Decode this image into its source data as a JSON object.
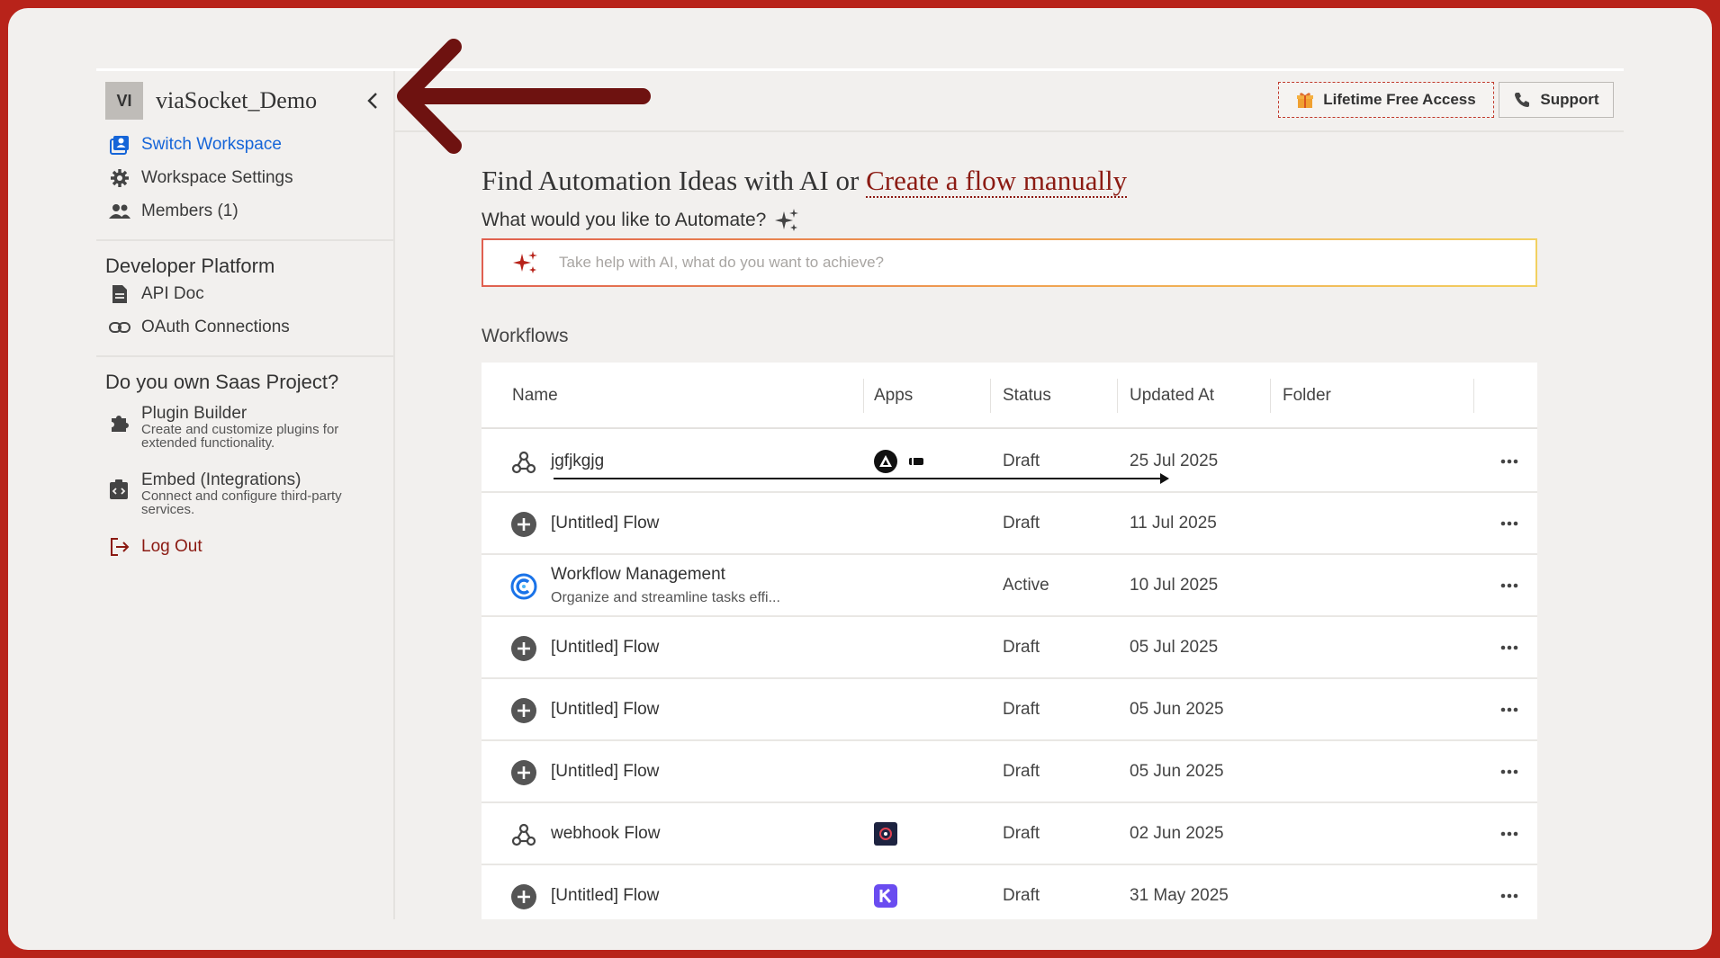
{
  "colors": {
    "frame": "#b8231a",
    "background": "#f2f0ee",
    "accent_blue": "#1565d8",
    "accent_red": "#8b1a12"
  },
  "sidebar": {
    "workspace_badge": "VI",
    "workspace_name": "viaSocket_Demo",
    "items": [
      {
        "label": "Switch Workspace",
        "icon": "switch-workspace-icon"
      },
      {
        "label": "Workspace Settings",
        "icon": "gear-icon"
      },
      {
        "label": "Members (1)",
        "icon": "members-icon"
      }
    ],
    "developer_title": "Developer Platform",
    "developer_items": [
      {
        "label": "API Doc",
        "icon": "document-icon"
      },
      {
        "label": "OAuth Connections",
        "icon": "link-icon"
      }
    ],
    "saas_title": "Do you own Saas Project?",
    "saas_items": [
      {
        "label": "Plugin Builder",
        "desc": "Create and customize plugins for extended functionality.",
        "icon": "puzzle-icon"
      },
      {
        "label": "Embed (Integrations)",
        "desc": "Connect and configure third-party services.",
        "icon": "embed-icon"
      }
    ],
    "logout": "Log Out"
  },
  "topbar": {
    "lifetime_label": "Lifetime Free Access",
    "support_label": "Support"
  },
  "main": {
    "headline_prefix": "Find Automation Ideas with AI or ",
    "headline_link": "Create a flow manually",
    "subhead": "What would you like to Automate?",
    "ai_placeholder": "Take help with AI, what do you want to achieve?",
    "workflows_title": "Workflows"
  },
  "table": {
    "columns": [
      "Name",
      "Apps",
      "Status",
      "Updated At",
      "Folder"
    ],
    "rows": [
      {
        "name": "jgfjkgjg",
        "desc": "",
        "status": "Draft",
        "updated": "25 Jul 2025",
        "icon": "webhook-icon",
        "apps": [
          "triangle-app-icon",
          "pill-app-icon"
        ]
      },
      {
        "name": "[Untitled] Flow",
        "desc": "",
        "status": "Draft",
        "updated": "11 Jul 2025",
        "icon": "plus-circle-icon",
        "apps": []
      },
      {
        "name": "Workflow Management",
        "desc": "Organize and streamline tasks effi...",
        "status": "Active",
        "updated": "10 Jul 2025",
        "icon": "calendly-icon",
        "apps": []
      },
      {
        "name": "[Untitled] Flow",
        "desc": "",
        "status": "Draft",
        "updated": "05 Jul 2025",
        "icon": "plus-circle-icon",
        "apps": []
      },
      {
        "name": "[Untitled] Flow",
        "desc": "",
        "status": "Draft",
        "updated": "05 Jun 2025",
        "icon": "plus-circle-icon",
        "apps": []
      },
      {
        "name": "[Untitled] Flow",
        "desc": "",
        "status": "Draft",
        "updated": "05 Jun 2025",
        "icon": "plus-circle-icon",
        "apps": []
      },
      {
        "name": "webhook Flow",
        "desc": "",
        "status": "Draft",
        "updated": "02 Jun 2025",
        "icon": "webhook-icon",
        "apps": [
          "dark-app-icon"
        ]
      },
      {
        "name": "[Untitled] Flow",
        "desc": "",
        "status": "Draft",
        "updated": "31 May 2025",
        "icon": "plus-circle-icon",
        "apps": [
          "purple-app-icon"
        ]
      }
    ]
  }
}
